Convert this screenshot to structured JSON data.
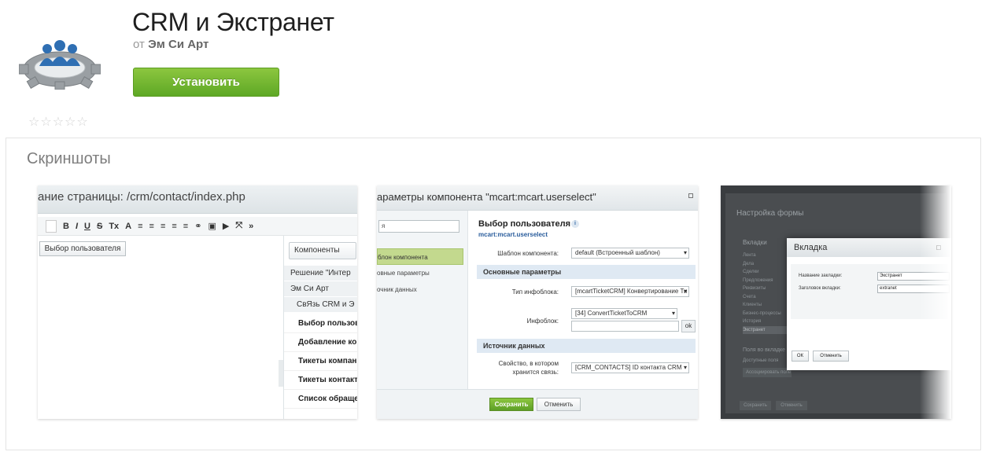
{
  "header": {
    "title": "CRM и Экстранет",
    "vendor_prefix": "от",
    "vendor_name": "Эм Си Арт",
    "install_label": "Установить",
    "rating_stars": [
      "☆",
      "☆",
      "☆",
      "☆",
      "☆"
    ]
  },
  "screenshots": {
    "title": "Скриншоты",
    "shot1": {
      "title": "ание страницы: /crm/contact/index.php",
      "toolbar": [
        "B",
        "I",
        "U",
        "S",
        "Tx",
        "A",
        "≡",
        "≡",
        "≡",
        "≡",
        "≡",
        "⚭",
        "▣",
        "▶",
        "⤧",
        "»"
      ],
      "user_button": "Выбор пользователя",
      "components_button": "Компоненты",
      "tree": [
        "Решение \"Интер",
        "Эм Си Арт",
        "СвЯзь CRM и Э"
      ],
      "list": [
        "Выбор пользова",
        "Добавление кон",
        "Тикеты компани",
        "Тикеты контакта",
        "Список обращен"
      ]
    },
    "shot2": {
      "title": "араметры компонента \"mcart:mcart.userselect\"",
      "search_value": "я",
      "nav": [
        "блон компонента",
        "овные параметры",
        "очник данных"
      ],
      "heading": "Выбор пользователя",
      "subheading": "mcart:mcart.userselect",
      "info": "i",
      "template_label": "Шаблон компонента:",
      "template_value": "default (Встроенный шаблон)",
      "section_main": "Основные параметры",
      "iblock_type_label": "Тип инфоблока:",
      "iblock_type_value": "[mcartTicketCRM] Конвертирование Ти",
      "iblock_label": "Инфоблок:",
      "iblock_value": "[34] ConvertTicketToCRM",
      "ok": "ok",
      "section_source": "Источник данных",
      "prop_label_1": "Свойство, в котором",
      "prop_label_2": "хранится связь:",
      "prop_value": "[CRM_CONTACTS] ID контакта CRM",
      "save": "Сохранить",
      "cancel": "Отменить"
    },
    "shot3": {
      "bg_title": "Настройка формы",
      "tabs_header": "Вкладки",
      "tabs": [
        "Лента",
        "Дела",
        "Сделки",
        "Предложения",
        "Реквизиты",
        "Счета",
        "Клиенты",
        "Бизнес-процессы",
        "История",
        "Экстранет"
      ],
      "fields_header": "Поля во вкладке",
      "fields_available": "Доступные поля",
      "assoc": "Ассоциировать поле",
      "bg_save": "Сохранить",
      "bg_cancel": "Отменить",
      "dialog_title": "Вкладка",
      "tab_name_label": "Название закладки:",
      "tab_name_value": "Экстранет",
      "tab_header_label": "Заголовок вкладки:",
      "tab_header_value": "extranet",
      "ok": "ОК",
      "cancel": "Отменить"
    }
  }
}
